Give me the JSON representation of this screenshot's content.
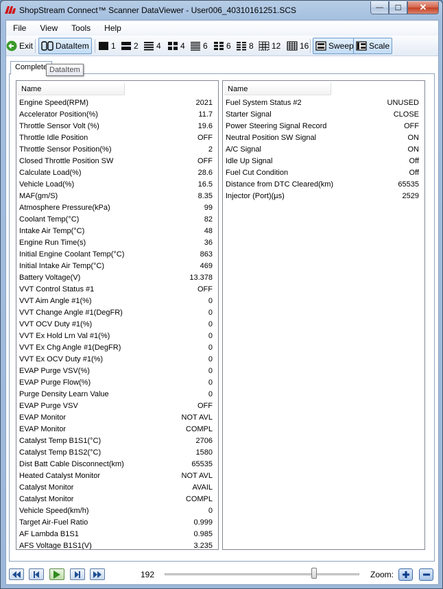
{
  "window": {
    "title": "ShopStream Connect™ Scanner DataViewer - User006_40310161251.SCS",
    "controls": {
      "minimize": "—",
      "maximize": "☐",
      "close": "✕"
    }
  },
  "menu": [
    "File",
    "View",
    "Tools",
    "Help"
  ],
  "toolbar": {
    "exit": "Exit",
    "dataitem": "DataItem",
    "layouts": [
      "1",
      "2",
      "4",
      "4",
      "6",
      "6",
      "8",
      "12",
      "16"
    ],
    "sweep": "Sweep",
    "scale": "Scale"
  },
  "tabs": {
    "active": "Complete",
    "tooltip": "DataItem"
  },
  "left_pane": {
    "header": "Name",
    "rows": [
      {
        "name": "Engine Speed(RPM)",
        "value": "2021"
      },
      {
        "name": "Accelerator Position(%)",
        "value": "11.7"
      },
      {
        "name": "Throttle Sensor Volt (%)",
        "value": "19.6"
      },
      {
        "name": "Throttle Idle Position",
        "value": "OFF"
      },
      {
        "name": "Throttle Sensor Position(%)",
        "value": "2"
      },
      {
        "name": "Closed Throttle Position SW",
        "value": "OFF"
      },
      {
        "name": "Calculate Load(%)",
        "value": "28.6"
      },
      {
        "name": "Vehicle Load(%)",
        "value": "16.5"
      },
      {
        "name": "MAF(gm/S)",
        "value": "8.35"
      },
      {
        "name": "Atmosphere Pressure(kPa)",
        "value": "99"
      },
      {
        "name": "Coolant Temp(°C)",
        "value": "82"
      },
      {
        "name": "Intake Air Temp(°C)",
        "value": "48"
      },
      {
        "name": "Engine Run Time(s)",
        "value": "36"
      },
      {
        "name": "Initial Engine Coolant Temp(°C)",
        "value": "863"
      },
      {
        "name": "Initial Intake Air Temp(°C)",
        "value": "469"
      },
      {
        "name": "Battery Voltage(V)",
        "value": "13.378"
      },
      {
        "name": "VVT Control Status #1",
        "value": "OFF"
      },
      {
        "name": "VVT Aim Angle #1(%)",
        "value": "0"
      },
      {
        "name": "VVT Change Angle #1(DegFR)",
        "value": "0"
      },
      {
        "name": "VVT OCV Duty #1(%)",
        "value": "0"
      },
      {
        "name": "VVT Ex Hold Lrn Val #1(%)",
        "value": "0"
      },
      {
        "name": "VVT Ex Chg Angle #1(DegFR)",
        "value": "0"
      },
      {
        "name": "VVT Ex OCV Duty #1(%)",
        "value": "0"
      },
      {
        "name": "EVAP Purge VSV(%)",
        "value": "0"
      },
      {
        "name": "EVAP Purge Flow(%)",
        "value": "0"
      },
      {
        "name": "Purge Density Learn Value",
        "value": "0"
      },
      {
        "name": "EVAP Purge VSV",
        "value": "OFF"
      },
      {
        "name": "EVAP Monitor",
        "value": "NOT AVL"
      },
      {
        "name": "EVAP Monitor",
        "value": "COMPL"
      },
      {
        "name": "Catalyst Temp B1S1(°C)",
        "value": "2706"
      },
      {
        "name": "Catalyst Temp B1S2(°C)",
        "value": "1580"
      },
      {
        "name": "Dist Batt Cable Disconnect(km)",
        "value": "65535"
      },
      {
        "name": "Heated Catalyst Monitor",
        "value": "NOT AVL"
      },
      {
        "name": "Catalyst Monitor",
        "value": "AVAIL"
      },
      {
        "name": "Catalyst Monitor",
        "value": "COMPL"
      },
      {
        "name": "Vehicle Speed(km/h)",
        "value": "0"
      },
      {
        "name": "Target Air-Fuel Ratio",
        "value": "0.999"
      },
      {
        "name": "AF Lambda B1S1",
        "value": "0.985"
      },
      {
        "name": "AFS Voltage B1S1(V)",
        "value": "3.235"
      }
    ]
  },
  "right_pane": {
    "header": "Name",
    "rows": [
      {
        "name": "Fuel System Status #2",
        "value": "UNUSED"
      },
      {
        "name": "Starter Signal",
        "value": "CLOSE"
      },
      {
        "name": "Power Steering Signal Record",
        "value": "OFF"
      },
      {
        "name": "Neutral Position SW Signal",
        "value": "ON"
      },
      {
        "name": "A/C Signal",
        "value": "ON"
      },
      {
        "name": "Idle Up Signal",
        "value": "Off"
      },
      {
        "name": "Fuel Cut Condition",
        "value": "Off"
      },
      {
        "name": "Distance from DTC Cleared(km)",
        "value": "65535"
      },
      {
        "name": "Injector (Port)(µs)",
        "value": "2529"
      }
    ]
  },
  "playback": {
    "frame": "192",
    "zoom_label": "Zoom:"
  },
  "colors": {
    "accent": "#3f6aa8",
    "play_green": "#2f8a1e",
    "logo_red": "#d01010"
  },
  "icons": [
    "logo-icon",
    "exit-icon",
    "dataitem-icon",
    "layout-icon",
    "sweep-icon",
    "scale-icon",
    "first-icon",
    "prev-icon",
    "play-icon",
    "next-icon",
    "last-icon",
    "zoom-in-icon",
    "zoom-out-icon"
  ]
}
